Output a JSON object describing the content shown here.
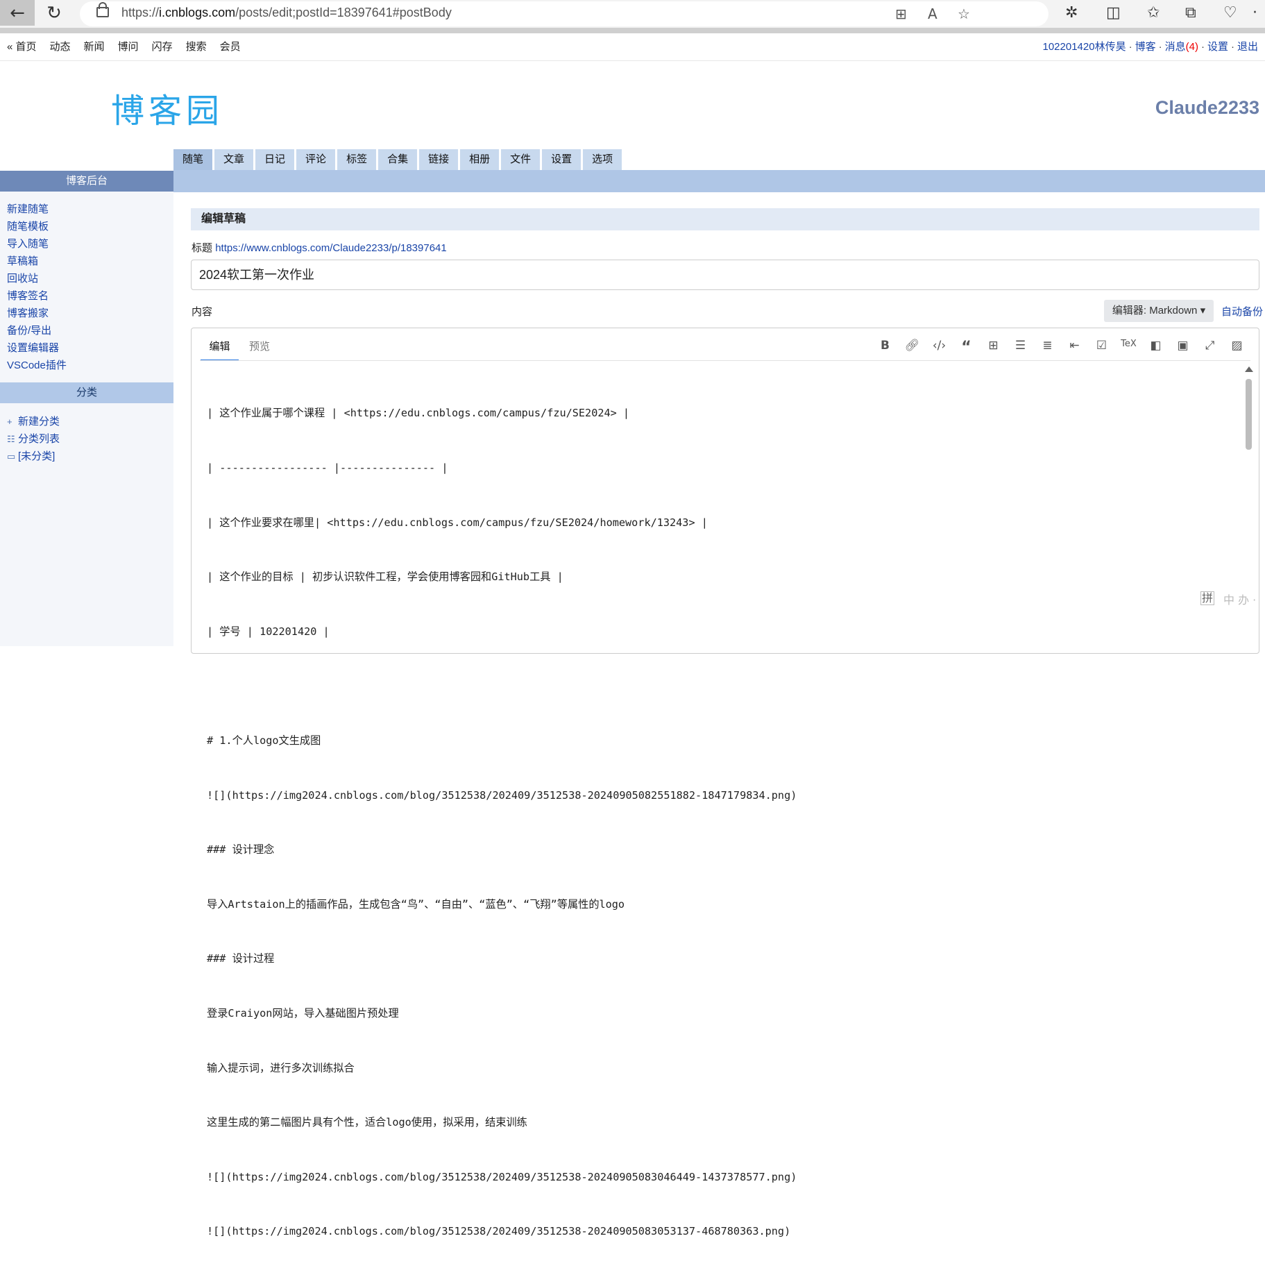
{
  "browser": {
    "url_prefix": "https://",
    "url_host": "i.cnblogs.com",
    "url_path": "/posts/edit;postId=18397641#postBody"
  },
  "topnav": {
    "items": [
      "« 首页",
      "动态",
      "新闻",
      "博问",
      "闪存",
      "搜索",
      "会员"
    ]
  },
  "userbar": {
    "username": "102201420林传昊",
    "blog": "博客",
    "messages": "消息",
    "message_count": "(4)",
    "settings": "设置",
    "logout": "退出",
    "sep": "·"
  },
  "logo_text": "博客园",
  "blog_name": "Claude2233",
  "tabs": [
    "随笔",
    "文章",
    "日记",
    "评论",
    "标签",
    "合集",
    "链接",
    "相册",
    "文件",
    "设置",
    "选项"
  ],
  "sidebar": {
    "header": "博客后台",
    "items": [
      "新建随笔",
      "随笔模板",
      "导入随笔",
      "草稿箱",
      "回收站",
      "博客签名",
      "博客搬家",
      "备份/导出",
      "设置编辑器",
      "VSCode插件"
    ],
    "category_header": "分类",
    "category_items": [
      "新建分类",
      "分类列表",
      "[未分类]"
    ]
  },
  "main": {
    "section_title": "编辑草稿",
    "title_label": "标题",
    "title_link": "https://www.cnblogs.com/Claude2233/p/18397641",
    "title_value": "2024软工第一次作业",
    "content_label": "内容",
    "editor_select": "编辑器: Markdown ▾",
    "autosave": "自动备份",
    "editor_tab_edit": "编辑",
    "editor_tab_preview": "预览",
    "code_lines": [
      "| 这个作业属于哪个课程 | <https://edu.cnblogs.com/campus/fzu/SE2024> |",
      "| ----------------- |--------------- |",
      "| 这个作业要求在哪里| <https://edu.cnblogs.com/campus/fzu/SE2024/homework/13243> |",
      "| 这个作业的目标 | 初步认识软件工程，学会使用博客园和GitHub工具 |",
      "| 学号 | 102201420 |",
      "",
      "# 1.个人logo文生成图",
      "![](https://img2024.cnblogs.com/blog/3512538/202409/3512538-20240905082551882-1847179834.png)",
      "### 设计理念",
      "导入Artstaion上的插画作品，生成包含“鸟”、“自由”、“蓝色”、“飞翔”等属性的logo",
      "### 设计过程",
      "登录Craiyon网站，导入基础图片预处理",
      "输入提示词，进行多次训练拟合",
      "这里生成的第二幅图片具有个性，适合logo使用，拟采用，结束训练",
      "![](https://img2024.cnblogs.com/blog/3512538/202409/3512538-20240905083046449-1437378577.png)",
      "![](https://img2024.cnblogs.com/blog/3512538/202409/3512538-20240905083053137-468780363.png)"
    ]
  },
  "ime": {
    "icon": "拼",
    "text": "中 办 ·"
  }
}
